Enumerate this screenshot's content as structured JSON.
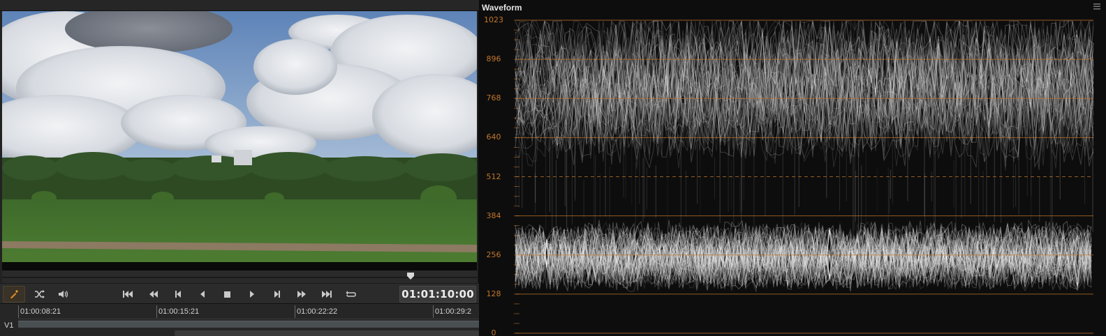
{
  "viewer": {
    "timecode": "01:01:10:00",
    "playhead_fraction": 0.86,
    "transport": {
      "tool_icon": "eyedropper-icon",
      "buttons": [
        {
          "name": "shuffle-icon"
        },
        {
          "name": "speaker-icon"
        },
        {
          "name": "go-to-start-icon"
        },
        {
          "name": "rewind-icon"
        },
        {
          "name": "previous-frame-icon"
        },
        {
          "name": "reverse-play-icon"
        },
        {
          "name": "stop-icon"
        },
        {
          "name": "play-icon"
        },
        {
          "name": "next-frame-icon"
        },
        {
          "name": "fast-forward-icon"
        },
        {
          "name": "go-to-end-icon"
        },
        {
          "name": "loop-icon"
        }
      ]
    },
    "timeline": {
      "track_label": "V1",
      "ruler_labels": [
        "01:00:08:21",
        "01:00:15:21",
        "01:00:22:22",
        "01:00:29:2"
      ]
    }
  },
  "scope": {
    "title": "Waveform",
    "axis_labels": [
      "1023",
      "896",
      "768",
      "640",
      "512",
      "384",
      "256",
      "128",
      "0"
    ],
    "accent_color": "#c3772a"
  }
}
